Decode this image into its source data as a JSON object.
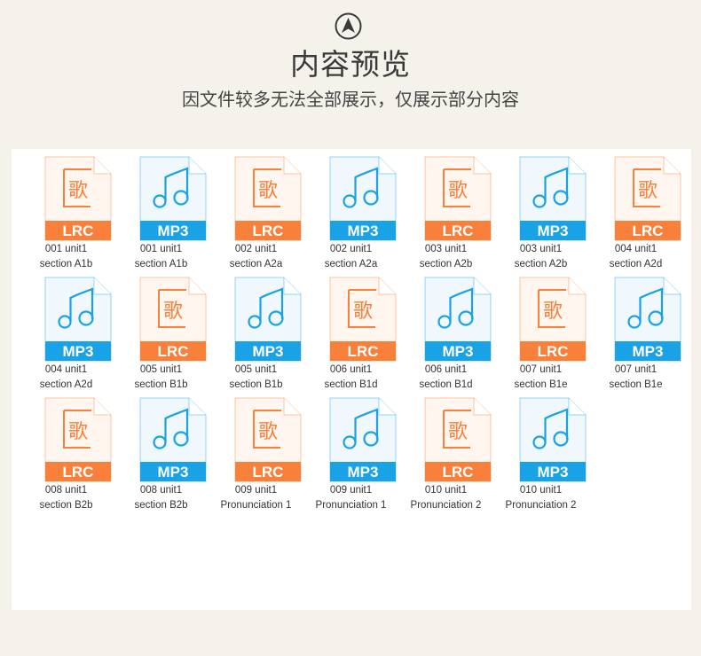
{
  "header": {
    "title": "内容预览",
    "subtitle": "因文件较多无法全部展示，仅展示部分内容"
  },
  "colors": {
    "lrc": "#f8803a",
    "mp3": "#1aa2e6",
    "background": "#f5f2ec"
  },
  "icons": {
    "lrc": "lyrics-file-icon",
    "mp3": "music-file-icon"
  },
  "files": [
    {
      "type": "LRC",
      "line1": "001 unit1",
      "line2": "section A1b"
    },
    {
      "type": "MP3",
      "line1": "001 unit1",
      "line2": "section A1b"
    },
    {
      "type": "LRC",
      "line1": "002 unit1",
      "line2": "section A2a"
    },
    {
      "type": "MP3",
      "line1": "002 unit1",
      "line2": "section A2a"
    },
    {
      "type": "LRC",
      "line1": "003 unit1",
      "line2": "section A2b"
    },
    {
      "type": "MP3",
      "line1": "003 unit1",
      "line2": "section A2b"
    },
    {
      "type": "LRC",
      "line1": "004 unit1",
      "line2": "section A2d"
    },
    {
      "type": "MP3",
      "line1": "004 unit1",
      "line2": "section A2d"
    },
    {
      "type": "LRC",
      "line1": "005 unit1",
      "line2": "section B1b"
    },
    {
      "type": "MP3",
      "line1": "005 unit1",
      "line2": "section B1b"
    },
    {
      "type": "LRC",
      "line1": "006 unit1",
      "line2": "section B1d"
    },
    {
      "type": "MP3",
      "line1": "006 unit1",
      "line2": "section B1d"
    },
    {
      "type": "LRC",
      "line1": "007 unit1",
      "line2": "section B1e"
    },
    {
      "type": "MP3",
      "line1": "007 unit1",
      "line2": "section B1e"
    },
    {
      "type": "LRC",
      "line1": "008 unit1",
      "line2": "section B2b"
    },
    {
      "type": "MP3",
      "line1": "008 unit1",
      "line2": "section B2b"
    },
    {
      "type": "LRC",
      "line1": "009 unit1",
      "line2": "Pronunciation 1"
    },
    {
      "type": "MP3",
      "line1": "009 unit1",
      "line2": "Pronunciation 1"
    },
    {
      "type": "LRC",
      "line1": "010 unit1",
      "line2": "Pronunciation 2"
    },
    {
      "type": "MP3",
      "line1": "010 unit1",
      "line2": "Pronunciation 2"
    }
  ]
}
